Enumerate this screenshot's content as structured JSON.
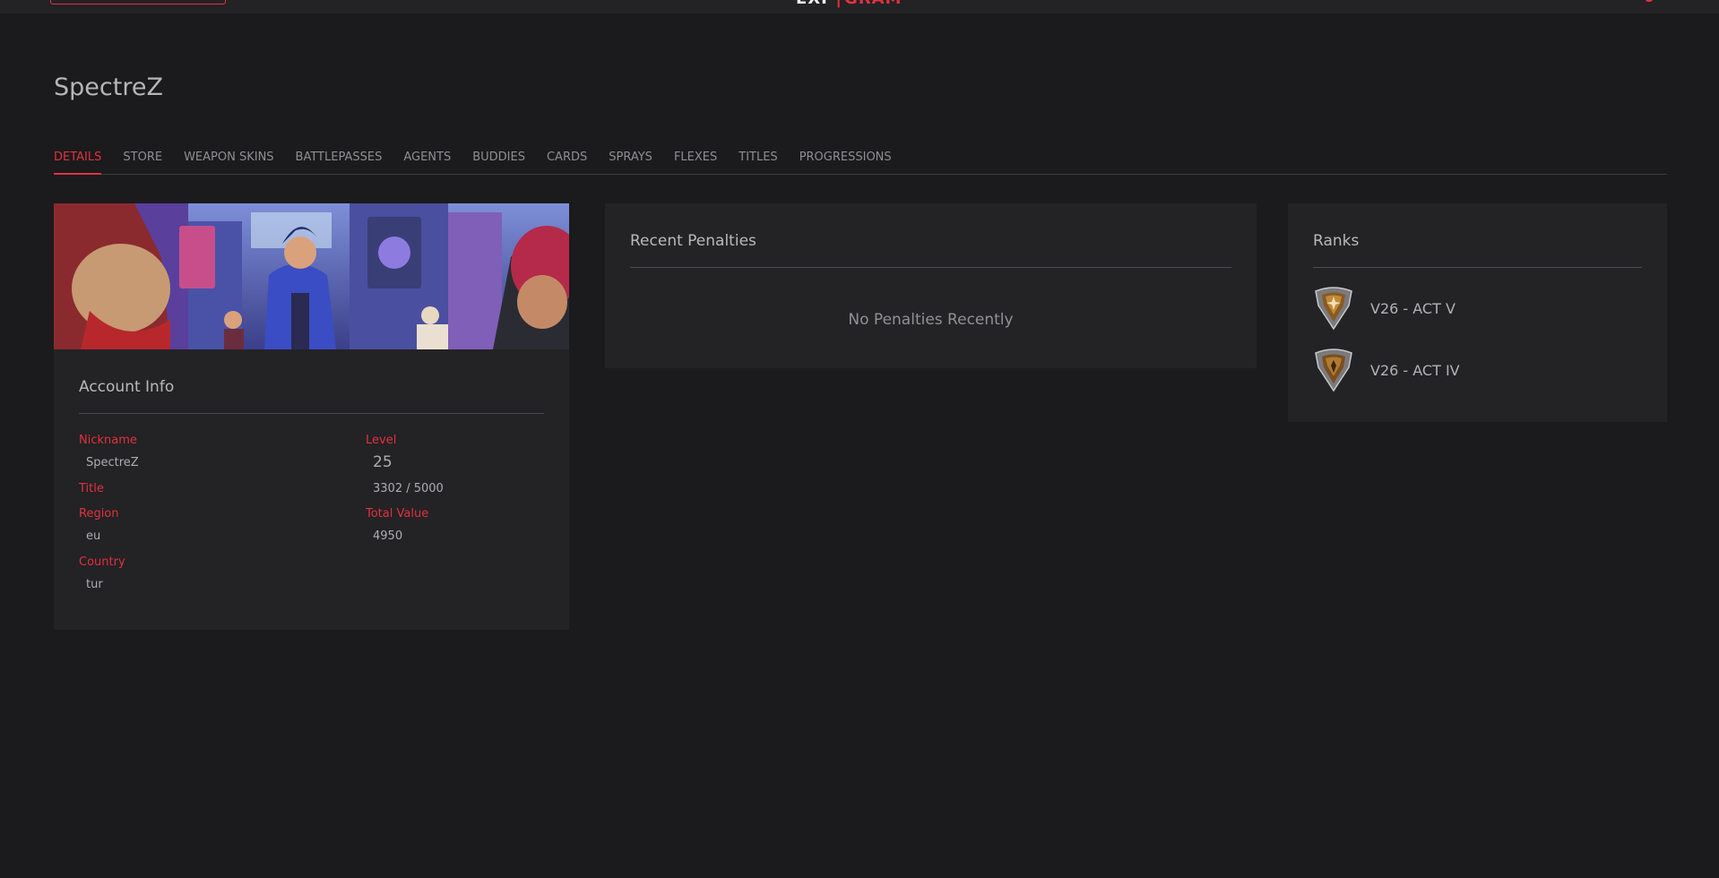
{
  "header": {
    "logo_left": "EXP",
    "logo_sep": "|",
    "logo_right": "GRAM"
  },
  "profile": {
    "name": "SpectreZ"
  },
  "tabs": [
    {
      "label": "DETAILS",
      "active": true
    },
    {
      "label": "STORE"
    },
    {
      "label": "WEAPON SKINS"
    },
    {
      "label": "BATTLEPASSES"
    },
    {
      "label": "AGENTS"
    },
    {
      "label": "BUDDIES"
    },
    {
      "label": "CARDS"
    },
    {
      "label": "SPRAYS"
    },
    {
      "label": "FLEXES"
    },
    {
      "label": "TITLES"
    },
    {
      "label": "PROGRESSIONS"
    }
  ],
  "account_info": {
    "title": "Account Info",
    "nickname_label": "Nickname",
    "nickname": "SpectreZ",
    "title_label": "Title",
    "region_label": "Region",
    "region": "eu",
    "country_label": "Country",
    "country": "tur",
    "level_label": "Level",
    "level": "25",
    "xp": "3302 / 5000",
    "total_value_label": "Total Value",
    "total_value": "4950"
  },
  "penalties": {
    "title": "Recent Penalties",
    "empty": "No Penalties Recently"
  },
  "ranks": {
    "title": "Ranks",
    "items": [
      {
        "label": "V26 - ACT V"
      },
      {
        "label": "V26 - ACT IV"
      }
    ]
  },
  "colors": {
    "accent": "#e0323e",
    "background": "#1b1a1c",
    "card": "#232225"
  }
}
